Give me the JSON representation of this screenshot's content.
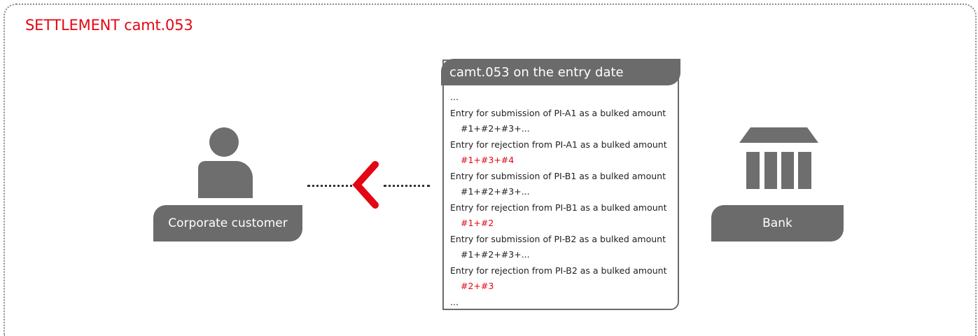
{
  "section": {
    "title": "SETTLEMENT camt.053"
  },
  "actors": {
    "customer": {
      "label": "Corporate customer",
      "icon": "person-icon"
    },
    "bank": {
      "label": "Bank",
      "icon": "bank-icon"
    }
  },
  "flow": {
    "direction_icon": "chevron-left-icon"
  },
  "statement": {
    "title": "camt.053 on the entry date",
    "lines": [
      {
        "text": "...",
        "indent": false,
        "highlight": false
      },
      {
        "text": "Entry for submission of PI-A1 as a bulked amount",
        "indent": false,
        "highlight": false
      },
      {
        "text": "#1+#2+#3+...",
        "indent": true,
        "highlight": false
      },
      {
        "text": "Entry for rejection from PI-A1 as a bulked amount",
        "indent": false,
        "highlight": false
      },
      {
        "text": "#1+#3+#4",
        "indent": true,
        "highlight": true
      },
      {
        "text": "Entry for submission of PI-B1 as a bulked amount",
        "indent": false,
        "highlight": false
      },
      {
        "text": "#1+#2+#3+...",
        "indent": true,
        "highlight": false
      },
      {
        "text": "Entry for rejection from PI-B1 as a bulked amount",
        "indent": false,
        "highlight": false
      },
      {
        "text": "#1+#2",
        "indent": true,
        "highlight": true
      },
      {
        "text": "Entry for submission of PI-B2 as a bulked amount",
        "indent": false,
        "highlight": false
      },
      {
        "text": "#1+#2+#3+...",
        "indent": true,
        "highlight": false
      },
      {
        "text": "Entry for rejection from PI-B2 as a bulked amount",
        "indent": false,
        "highlight": false
      },
      {
        "text": "#2+#3",
        "indent": true,
        "highlight": true
      },
      {
        "text": "...",
        "indent": false,
        "highlight": false
      }
    ]
  },
  "colors": {
    "accent": "#e30613",
    "text": "#222222",
    "box_fill": "#6b6b6b",
    "icon_fill": "#6e6e6e",
    "frame_border": "#8a8a8a"
  }
}
